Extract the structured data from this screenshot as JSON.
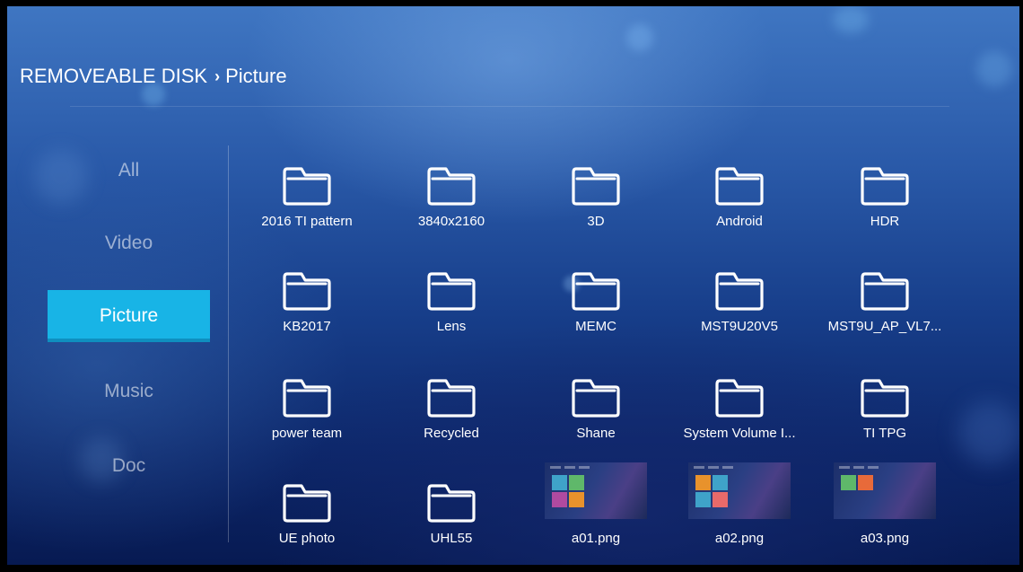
{
  "breadcrumb": {
    "root": "REMOVEABLE DISK",
    "separator": "›",
    "current": "Picture"
  },
  "sidebar": {
    "items": [
      {
        "label": "All",
        "active": false
      },
      {
        "label": "Video",
        "active": false
      },
      {
        "label": "Picture",
        "active": true
      },
      {
        "label": "Music",
        "active": false
      },
      {
        "label": "Doc",
        "active": false
      }
    ]
  },
  "files": [
    {
      "name": "2016 TI pattern",
      "type": "folder",
      "icon": "folder-icon"
    },
    {
      "name": "3840x2160",
      "type": "folder",
      "icon": "folder-icon"
    },
    {
      "name": "3D",
      "type": "folder",
      "icon": "folder-icon"
    },
    {
      "name": "Android",
      "type": "folder",
      "icon": "folder-icon"
    },
    {
      "name": "HDR",
      "type": "folder",
      "icon": "folder-icon"
    },
    {
      "name": "KB2017",
      "type": "folder",
      "icon": "folder-icon"
    },
    {
      "name": "Lens",
      "type": "folder",
      "icon": "folder-icon"
    },
    {
      "name": "MEMC",
      "type": "folder",
      "icon": "folder-icon"
    },
    {
      "name": "MST9U20V5",
      "type": "folder",
      "icon": "folder-icon"
    },
    {
      "name": "MST9U_AP_VL7...",
      "type": "folder",
      "icon": "folder-icon"
    },
    {
      "name": "power team",
      "type": "folder",
      "icon": "folder-icon"
    },
    {
      "name": "Recycled",
      "type": "folder",
      "icon": "folder-icon"
    },
    {
      "name": "Shane",
      "type": "folder",
      "icon": "folder-icon"
    },
    {
      "name": "System Volume I...",
      "type": "folder",
      "icon": "folder-icon"
    },
    {
      "name": "TI TPG",
      "type": "folder",
      "icon": "folder-icon"
    },
    {
      "name": "UE photo",
      "type": "folder",
      "icon": "folder-icon"
    },
    {
      "name": "UHL55",
      "type": "folder",
      "icon": "folder-icon"
    },
    {
      "name": "a01.png",
      "type": "image",
      "icon": "image-thumbnail"
    },
    {
      "name": "a02.png",
      "type": "image",
      "icon": "image-thumbnail"
    },
    {
      "name": "a03.png",
      "type": "image",
      "icon": "image-thumbnail"
    }
  ],
  "colors": {
    "accent": "#18b4e6",
    "text": "#ffffff",
    "inactive_text": "rgba(255,255,255,0.55)"
  }
}
